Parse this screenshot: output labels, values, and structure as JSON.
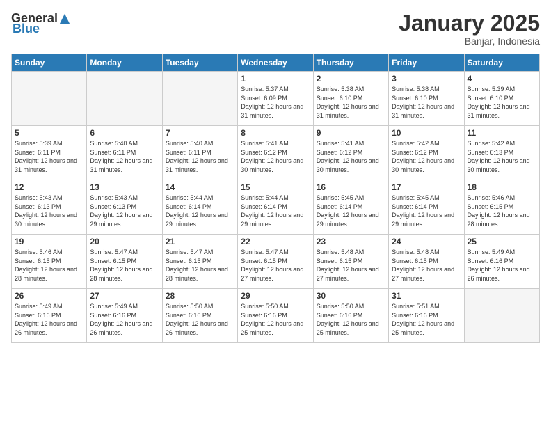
{
  "logo": {
    "text_general": "General",
    "text_blue": "Blue"
  },
  "header": {
    "month": "January 2025",
    "location": "Banjar, Indonesia"
  },
  "days_of_week": [
    "Sunday",
    "Monday",
    "Tuesday",
    "Wednesday",
    "Thursday",
    "Friday",
    "Saturday"
  ],
  "weeks": [
    [
      {
        "day": "",
        "sunrise": "",
        "sunset": "",
        "daylight": "",
        "empty": true
      },
      {
        "day": "",
        "sunrise": "",
        "sunset": "",
        "daylight": "",
        "empty": true
      },
      {
        "day": "",
        "sunrise": "",
        "sunset": "",
        "daylight": "",
        "empty": true
      },
      {
        "day": "1",
        "sunrise": "Sunrise: 5:37 AM",
        "sunset": "Sunset: 6:09 PM",
        "daylight": "Daylight: 12 hours and 31 minutes."
      },
      {
        "day": "2",
        "sunrise": "Sunrise: 5:38 AM",
        "sunset": "Sunset: 6:10 PM",
        "daylight": "Daylight: 12 hours and 31 minutes."
      },
      {
        "day": "3",
        "sunrise": "Sunrise: 5:38 AM",
        "sunset": "Sunset: 6:10 PM",
        "daylight": "Daylight: 12 hours and 31 minutes."
      },
      {
        "day": "4",
        "sunrise": "Sunrise: 5:39 AM",
        "sunset": "Sunset: 6:10 PM",
        "daylight": "Daylight: 12 hours and 31 minutes."
      }
    ],
    [
      {
        "day": "5",
        "sunrise": "Sunrise: 5:39 AM",
        "sunset": "Sunset: 6:11 PM",
        "daylight": "Daylight: 12 hours and 31 minutes."
      },
      {
        "day": "6",
        "sunrise": "Sunrise: 5:40 AM",
        "sunset": "Sunset: 6:11 PM",
        "daylight": "Daylight: 12 hours and 31 minutes."
      },
      {
        "day": "7",
        "sunrise": "Sunrise: 5:40 AM",
        "sunset": "Sunset: 6:11 PM",
        "daylight": "Daylight: 12 hours and 31 minutes."
      },
      {
        "day": "8",
        "sunrise": "Sunrise: 5:41 AM",
        "sunset": "Sunset: 6:12 PM",
        "daylight": "Daylight: 12 hours and 30 minutes."
      },
      {
        "day": "9",
        "sunrise": "Sunrise: 5:41 AM",
        "sunset": "Sunset: 6:12 PM",
        "daylight": "Daylight: 12 hours and 30 minutes."
      },
      {
        "day": "10",
        "sunrise": "Sunrise: 5:42 AM",
        "sunset": "Sunset: 6:12 PM",
        "daylight": "Daylight: 12 hours and 30 minutes."
      },
      {
        "day": "11",
        "sunrise": "Sunrise: 5:42 AM",
        "sunset": "Sunset: 6:13 PM",
        "daylight": "Daylight: 12 hours and 30 minutes."
      }
    ],
    [
      {
        "day": "12",
        "sunrise": "Sunrise: 5:43 AM",
        "sunset": "Sunset: 6:13 PM",
        "daylight": "Daylight: 12 hours and 30 minutes."
      },
      {
        "day": "13",
        "sunrise": "Sunrise: 5:43 AM",
        "sunset": "Sunset: 6:13 PM",
        "daylight": "Daylight: 12 hours and 29 minutes."
      },
      {
        "day": "14",
        "sunrise": "Sunrise: 5:44 AM",
        "sunset": "Sunset: 6:14 PM",
        "daylight": "Daylight: 12 hours and 29 minutes."
      },
      {
        "day": "15",
        "sunrise": "Sunrise: 5:44 AM",
        "sunset": "Sunset: 6:14 PM",
        "daylight": "Daylight: 12 hours and 29 minutes."
      },
      {
        "day": "16",
        "sunrise": "Sunrise: 5:45 AM",
        "sunset": "Sunset: 6:14 PM",
        "daylight": "Daylight: 12 hours and 29 minutes."
      },
      {
        "day": "17",
        "sunrise": "Sunrise: 5:45 AM",
        "sunset": "Sunset: 6:14 PM",
        "daylight": "Daylight: 12 hours and 29 minutes."
      },
      {
        "day": "18",
        "sunrise": "Sunrise: 5:46 AM",
        "sunset": "Sunset: 6:15 PM",
        "daylight": "Daylight: 12 hours and 28 minutes."
      }
    ],
    [
      {
        "day": "19",
        "sunrise": "Sunrise: 5:46 AM",
        "sunset": "Sunset: 6:15 PM",
        "daylight": "Daylight: 12 hours and 28 minutes."
      },
      {
        "day": "20",
        "sunrise": "Sunrise: 5:47 AM",
        "sunset": "Sunset: 6:15 PM",
        "daylight": "Daylight: 12 hours and 28 minutes."
      },
      {
        "day": "21",
        "sunrise": "Sunrise: 5:47 AM",
        "sunset": "Sunset: 6:15 PM",
        "daylight": "Daylight: 12 hours and 28 minutes."
      },
      {
        "day": "22",
        "sunrise": "Sunrise: 5:47 AM",
        "sunset": "Sunset: 6:15 PM",
        "daylight": "Daylight: 12 hours and 27 minutes."
      },
      {
        "day": "23",
        "sunrise": "Sunrise: 5:48 AM",
        "sunset": "Sunset: 6:15 PM",
        "daylight": "Daylight: 12 hours and 27 minutes."
      },
      {
        "day": "24",
        "sunrise": "Sunrise: 5:48 AM",
        "sunset": "Sunset: 6:15 PM",
        "daylight": "Daylight: 12 hours and 27 minutes."
      },
      {
        "day": "25",
        "sunrise": "Sunrise: 5:49 AM",
        "sunset": "Sunset: 6:16 PM",
        "daylight": "Daylight: 12 hours and 26 minutes."
      }
    ],
    [
      {
        "day": "26",
        "sunrise": "Sunrise: 5:49 AM",
        "sunset": "Sunset: 6:16 PM",
        "daylight": "Daylight: 12 hours and 26 minutes."
      },
      {
        "day": "27",
        "sunrise": "Sunrise: 5:49 AM",
        "sunset": "Sunset: 6:16 PM",
        "daylight": "Daylight: 12 hours and 26 minutes."
      },
      {
        "day": "28",
        "sunrise": "Sunrise: 5:50 AM",
        "sunset": "Sunset: 6:16 PM",
        "daylight": "Daylight: 12 hours and 26 minutes."
      },
      {
        "day": "29",
        "sunrise": "Sunrise: 5:50 AM",
        "sunset": "Sunset: 6:16 PM",
        "daylight": "Daylight: 12 hours and 25 minutes."
      },
      {
        "day": "30",
        "sunrise": "Sunrise: 5:50 AM",
        "sunset": "Sunset: 6:16 PM",
        "daylight": "Daylight: 12 hours and 25 minutes."
      },
      {
        "day": "31",
        "sunrise": "Sunrise: 5:51 AM",
        "sunset": "Sunset: 6:16 PM",
        "daylight": "Daylight: 12 hours and 25 minutes."
      },
      {
        "day": "",
        "sunrise": "",
        "sunset": "",
        "daylight": "",
        "empty": true
      }
    ]
  ]
}
